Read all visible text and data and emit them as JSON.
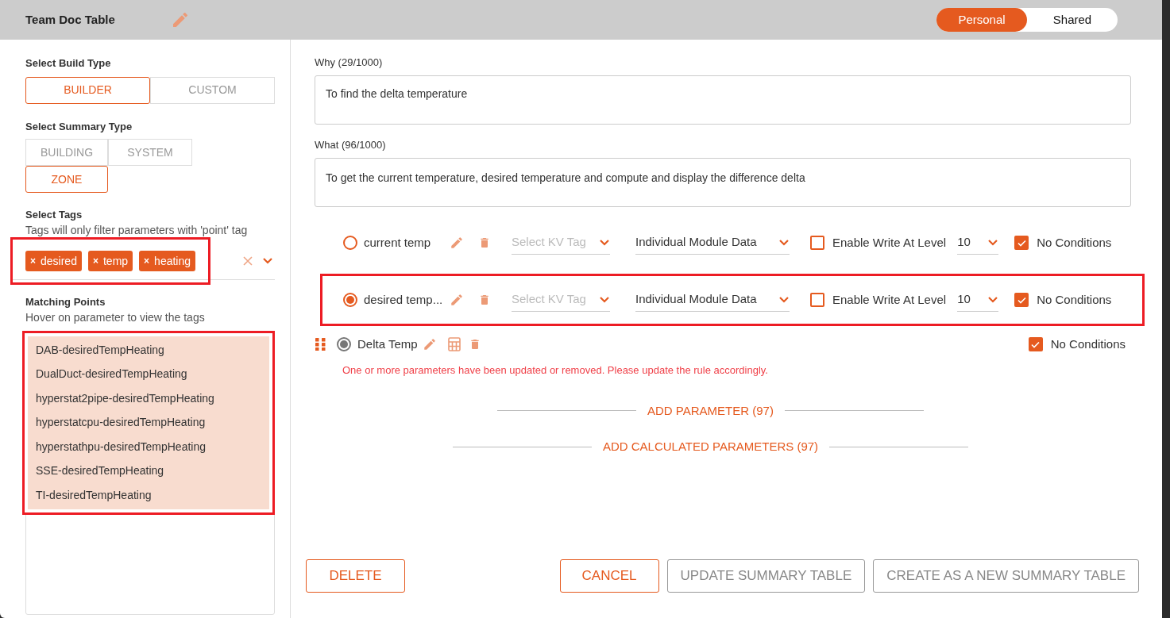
{
  "header": {
    "title": "Team Doc Table",
    "scope_tabs": [
      {
        "label": "Personal",
        "selected": true
      },
      {
        "label": "Shared",
        "selected": false
      }
    ]
  },
  "left": {
    "build_type": {
      "label": "Select Build Type",
      "options": [
        {
          "label": "BUILDER",
          "selected": true
        },
        {
          "label": "CUSTOM",
          "selected": false
        }
      ]
    },
    "summary_type": {
      "label": "Select Summary Type",
      "options": [
        {
          "label": "BUILDING",
          "selected": false
        },
        {
          "label": "SYSTEM",
          "selected": false
        },
        {
          "label": "ZONE",
          "selected": true
        }
      ]
    },
    "tags": {
      "label": "Select Tags",
      "hint": "Tags will only filter parameters with 'point' tag",
      "remove_glyph": "×",
      "items": [
        "desired",
        "temp",
        "heating"
      ]
    },
    "matching": {
      "label": "Matching Points",
      "hint": "Hover on parameter to view the tags",
      "items": [
        "DAB-desiredTempHeating",
        "DualDuct-desiredTempHeating",
        "hyperstat2pipe-desiredTempHeating",
        "hyperstatcpu-desiredTempHeating",
        "hyperstathpu-desiredTempHeating",
        "SSE-desiredTempHeating",
        "TI-desiredTempHeating"
      ]
    }
  },
  "why": {
    "label": "Why (29/1000)",
    "value": "To find the delta temperature"
  },
  "what": {
    "label": "What (96/1000)",
    "value": "To get the current temperature, desired temperature and compute and display the difference delta"
  },
  "parameters": [
    {
      "kind": "point",
      "name": "current temp",
      "selected": false,
      "highlighted": false,
      "kv_placeholder": "Select KV Tag",
      "data_source": "Individual Module Data",
      "enable_write": {
        "label": "Enable Write At Level",
        "checked": false
      },
      "level_value": "10",
      "no_conditions": {
        "label": "No Conditions",
        "checked": true
      }
    },
    {
      "kind": "point",
      "name": "desired temp...",
      "selected": true,
      "highlighted": true,
      "kv_placeholder": "Select KV Tag",
      "data_source": "Individual Module Data",
      "enable_write": {
        "label": "Enable Write At Level",
        "checked": false
      },
      "level_value": "10",
      "no_conditions": {
        "label": "No Conditions",
        "checked": true
      }
    },
    {
      "kind": "calculated",
      "name": "Delta Temp",
      "selected": true,
      "no_conditions": {
        "label": "No Conditions",
        "checked": true
      },
      "warning": "One or more parameters have been updated or removed. Please update the rule accordingly."
    }
  ],
  "add_links": [
    "ADD PARAMETER (97)",
    "ADD CALCULATED PARAMETERS (97)"
  ],
  "footer": {
    "delete": "DELETE",
    "cancel": "CANCEL",
    "update": {
      "label": "UPDATE SUMMARY TABLE",
      "disabled": true
    },
    "create": {
      "label": "CREATE AS A NEW SUMMARY TABLE",
      "disabled": true
    }
  }
}
